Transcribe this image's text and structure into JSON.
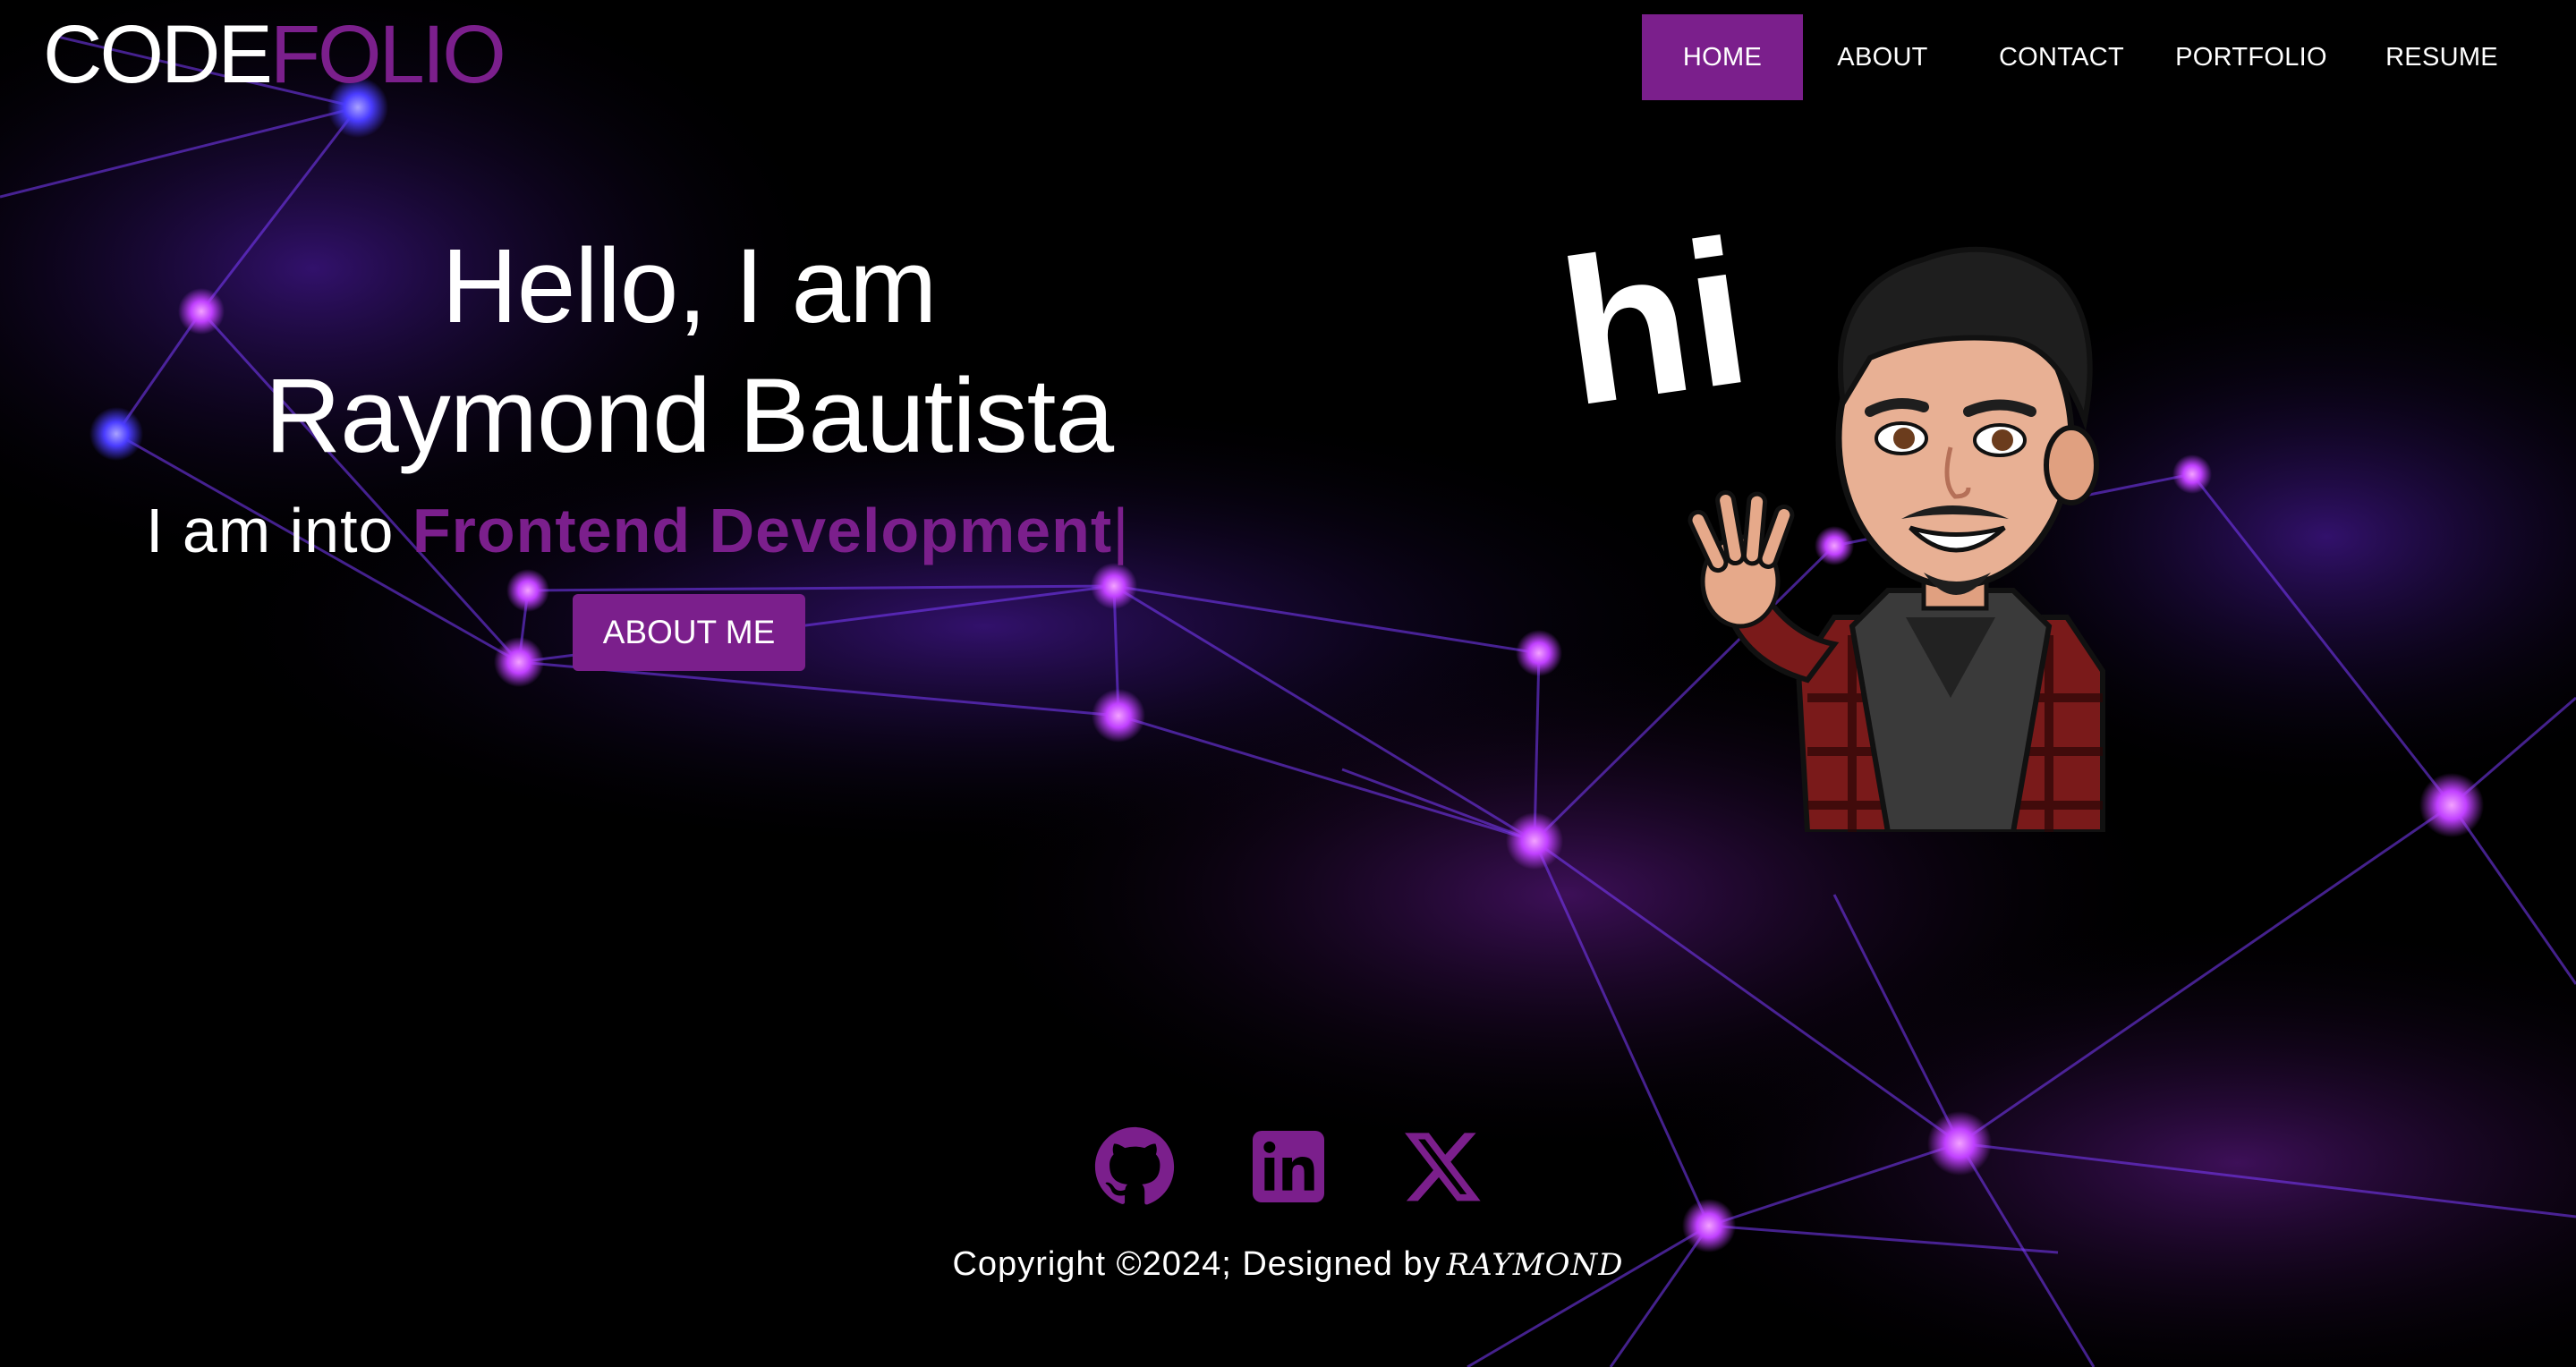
{
  "brand": {
    "code": "CODE",
    "folio": "FOLIO",
    "accent": "#7b1f8c"
  },
  "nav": {
    "items": [
      {
        "label": "HOME",
        "active": true
      },
      {
        "label": "ABOUT"
      },
      {
        "label": "CONTACT"
      },
      {
        "label": "PORTFOLIO"
      },
      {
        "label": "RESUME"
      }
    ]
  },
  "hero": {
    "line1": "Hello, I am",
    "line2": "Raymond Bautista",
    "into_prefix": "I am into ",
    "role": "Frontend Development",
    "cursor": "|",
    "button": "ABOUT ME",
    "avatar_text": "hi"
  },
  "social": {
    "icons": [
      "github-icon",
      "linkedin-icon",
      "x-icon"
    ]
  },
  "footer": {
    "copyright": "Copyright ©2024; Designed by",
    "designer": "RAYMOND"
  }
}
